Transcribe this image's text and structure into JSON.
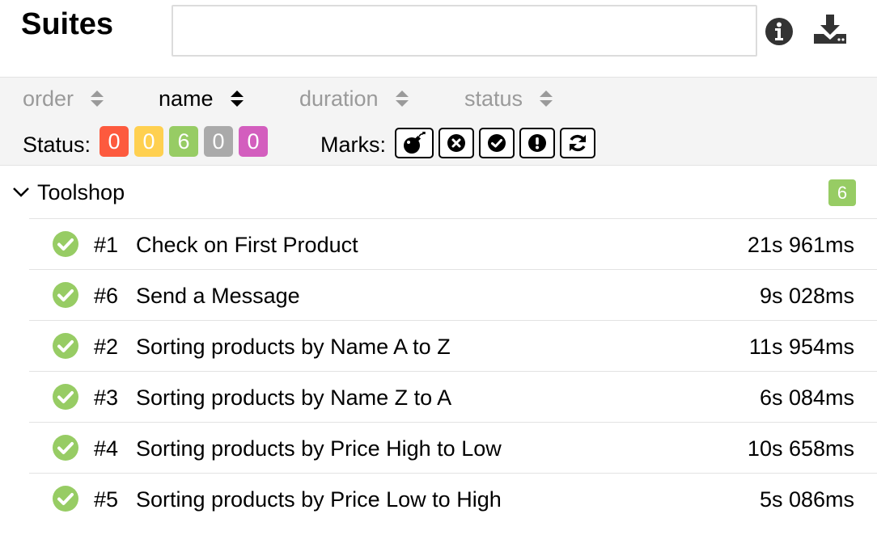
{
  "header": {
    "title": "Suites",
    "search_value": "",
    "info_icon": "info-circle-icon",
    "download_icon": "download-icon"
  },
  "sort": {
    "options": [
      {
        "label": "order",
        "active": false
      },
      {
        "label": "name",
        "active": true
      },
      {
        "label": "duration",
        "active": false
      },
      {
        "label": "status",
        "active": false
      }
    ]
  },
  "filters": {
    "status_label": "Status:",
    "status_counts": [
      {
        "status": "failed",
        "count": "0",
        "color": "#fd5a3e"
      },
      {
        "status": "broken",
        "count": "0",
        "color": "#ffd050"
      },
      {
        "status": "passed",
        "count": "6",
        "color": "#97cc64"
      },
      {
        "status": "skipped",
        "count": "0",
        "color": "#aaaaaa"
      },
      {
        "status": "unknown",
        "count": "0",
        "color": "#d35ebe"
      }
    ],
    "marks_label": "Marks:",
    "marks": [
      "bomb-icon",
      "times-circle-icon",
      "check-circle-icon",
      "exclamation-circle-icon",
      "refresh-icon"
    ]
  },
  "group": {
    "name": "Toolshop",
    "count": "6",
    "count_color": "#97cc64",
    "expanded": true
  },
  "tests": [
    {
      "num": "#1",
      "name": "Check on First Product",
      "duration": "21s 961ms",
      "status": "passed"
    },
    {
      "num": "#6",
      "name": "Send a Message",
      "duration": "9s 028ms",
      "status": "passed"
    },
    {
      "num": "#2",
      "name": "Sorting products by Name A to Z",
      "duration": "11s 954ms",
      "status": "passed"
    },
    {
      "num": "#3",
      "name": "Sorting products by Name Z to A",
      "duration": "6s 084ms",
      "status": "passed"
    },
    {
      "num": "#4",
      "name": "Sorting products by Price High to Low",
      "duration": "10s 658ms",
      "status": "passed"
    },
    {
      "num": "#5",
      "name": "Sorting products by Price Low to High",
      "duration": "5s 086ms",
      "status": "passed"
    }
  ],
  "colors": {
    "passed": "#97cc64",
    "toolbar_bg": "#f4f4f4"
  }
}
